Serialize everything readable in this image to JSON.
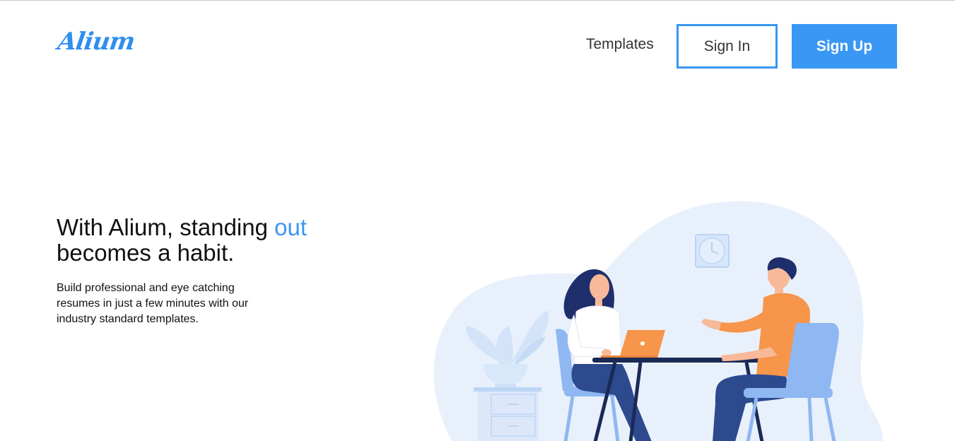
{
  "header": {
    "logo_text": "Alium",
    "nav": {
      "templates_label": "Templates"
    },
    "sign_in_label": "Sign In",
    "sign_up_label": "Sign Up"
  },
  "hero": {
    "title_part1": "With Alium, standing ",
    "title_accent": "out",
    "title_part2": "becomes a habit.",
    "subtitle": "Build professional and eye catching resumes in just a few minutes with our industry standard templates."
  },
  "colors": {
    "accent": "#3a97f4",
    "blob": "#e8f1fb",
    "shirt_orange": "#f7954a",
    "chair_blue": "#8fb7f2",
    "pants_navy": "#2d4a8f"
  }
}
